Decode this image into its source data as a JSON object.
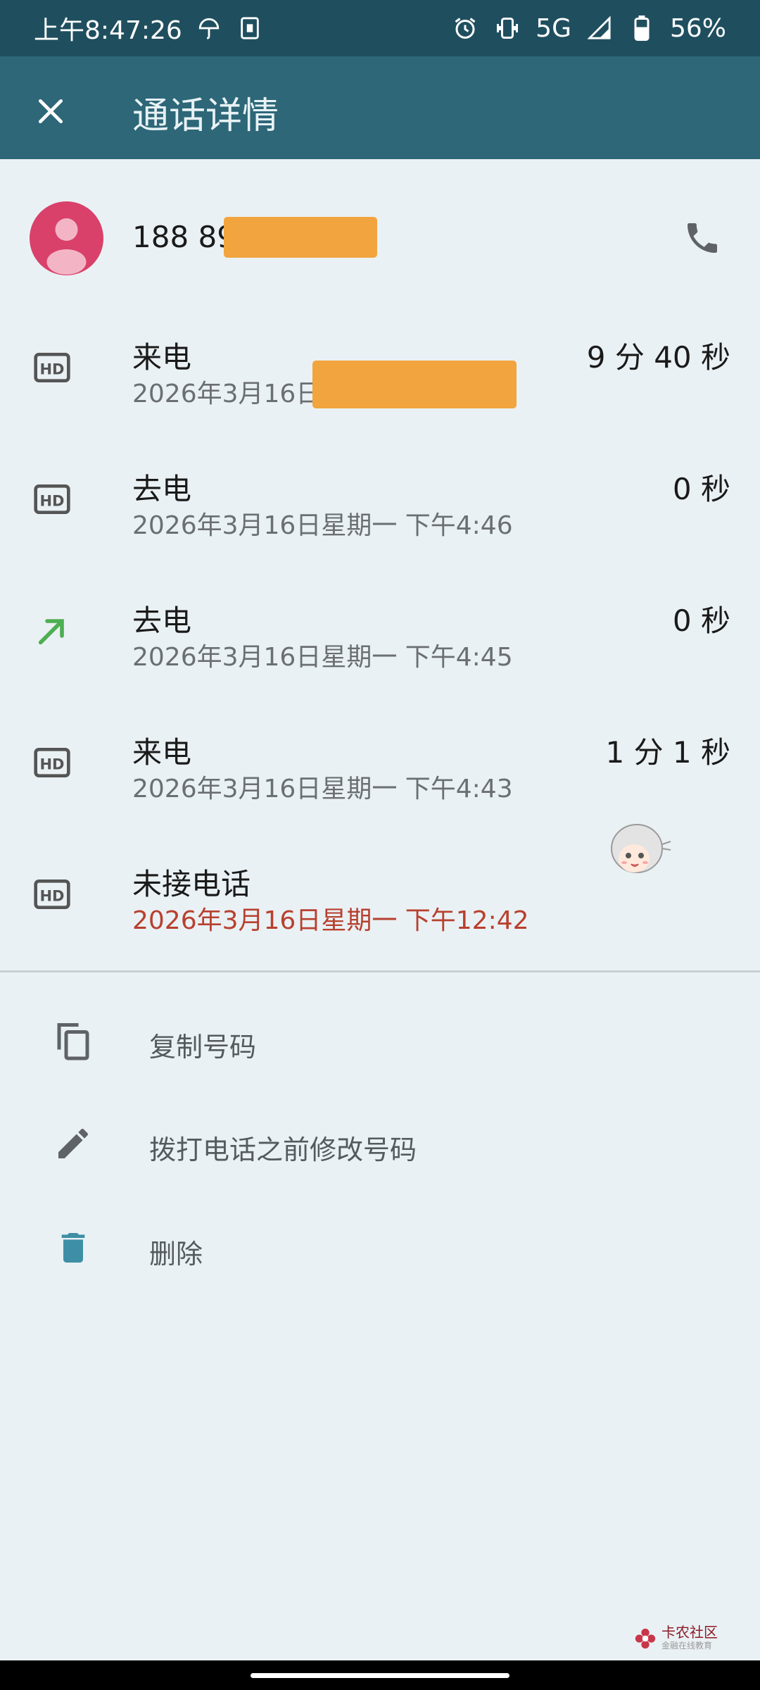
{
  "status_bar": {
    "time": "上午8:47:26",
    "network": "5G",
    "battery": "56%"
  },
  "app_bar": {
    "title": "通话详情"
  },
  "contact": {
    "number_visible": "188 89"
  },
  "call_log": [
    {
      "type": "来电",
      "time": "2026年3月16日",
      "duration": "9 分 40 秒",
      "icon": "hd-icon",
      "missed": false
    },
    {
      "type": "去电",
      "time": "2026年3月16日星期一 下午4:46",
      "duration": "0 秒",
      "icon": "hd-icon",
      "missed": false
    },
    {
      "type": "去电",
      "time": "2026年3月16日星期一 下午4:45",
      "duration": "0 秒",
      "icon": "outgoing-arrow-icon",
      "missed": false
    },
    {
      "type": "来电",
      "time": "2026年3月16日星期一 下午4:43",
      "duration": "1 分 1 秒",
      "icon": "hd-icon",
      "missed": false
    },
    {
      "type": "未接电话",
      "time": "2026年3月16日星期一 下午12:42",
      "duration": "",
      "icon": "hd-icon",
      "missed": true
    }
  ],
  "actions": [
    {
      "label": "复制号码",
      "icon": "copy-icon"
    },
    {
      "label": "拨打电话之前修改号码",
      "icon": "edit-icon"
    },
    {
      "label": "删除",
      "icon": "trash-icon"
    }
  ],
  "watermark": {
    "text": "卡农社区",
    "sub": "金融在线教育"
  },
  "colors": {
    "status_bar": "#1F4F5F",
    "app_bar": "#2D6778",
    "background": "#EAF1F4",
    "avatar": "#D9406A",
    "redaction": "#F2A43E",
    "missed_text": "#B8402F",
    "outgoing_arrow": "#4CAF50"
  }
}
